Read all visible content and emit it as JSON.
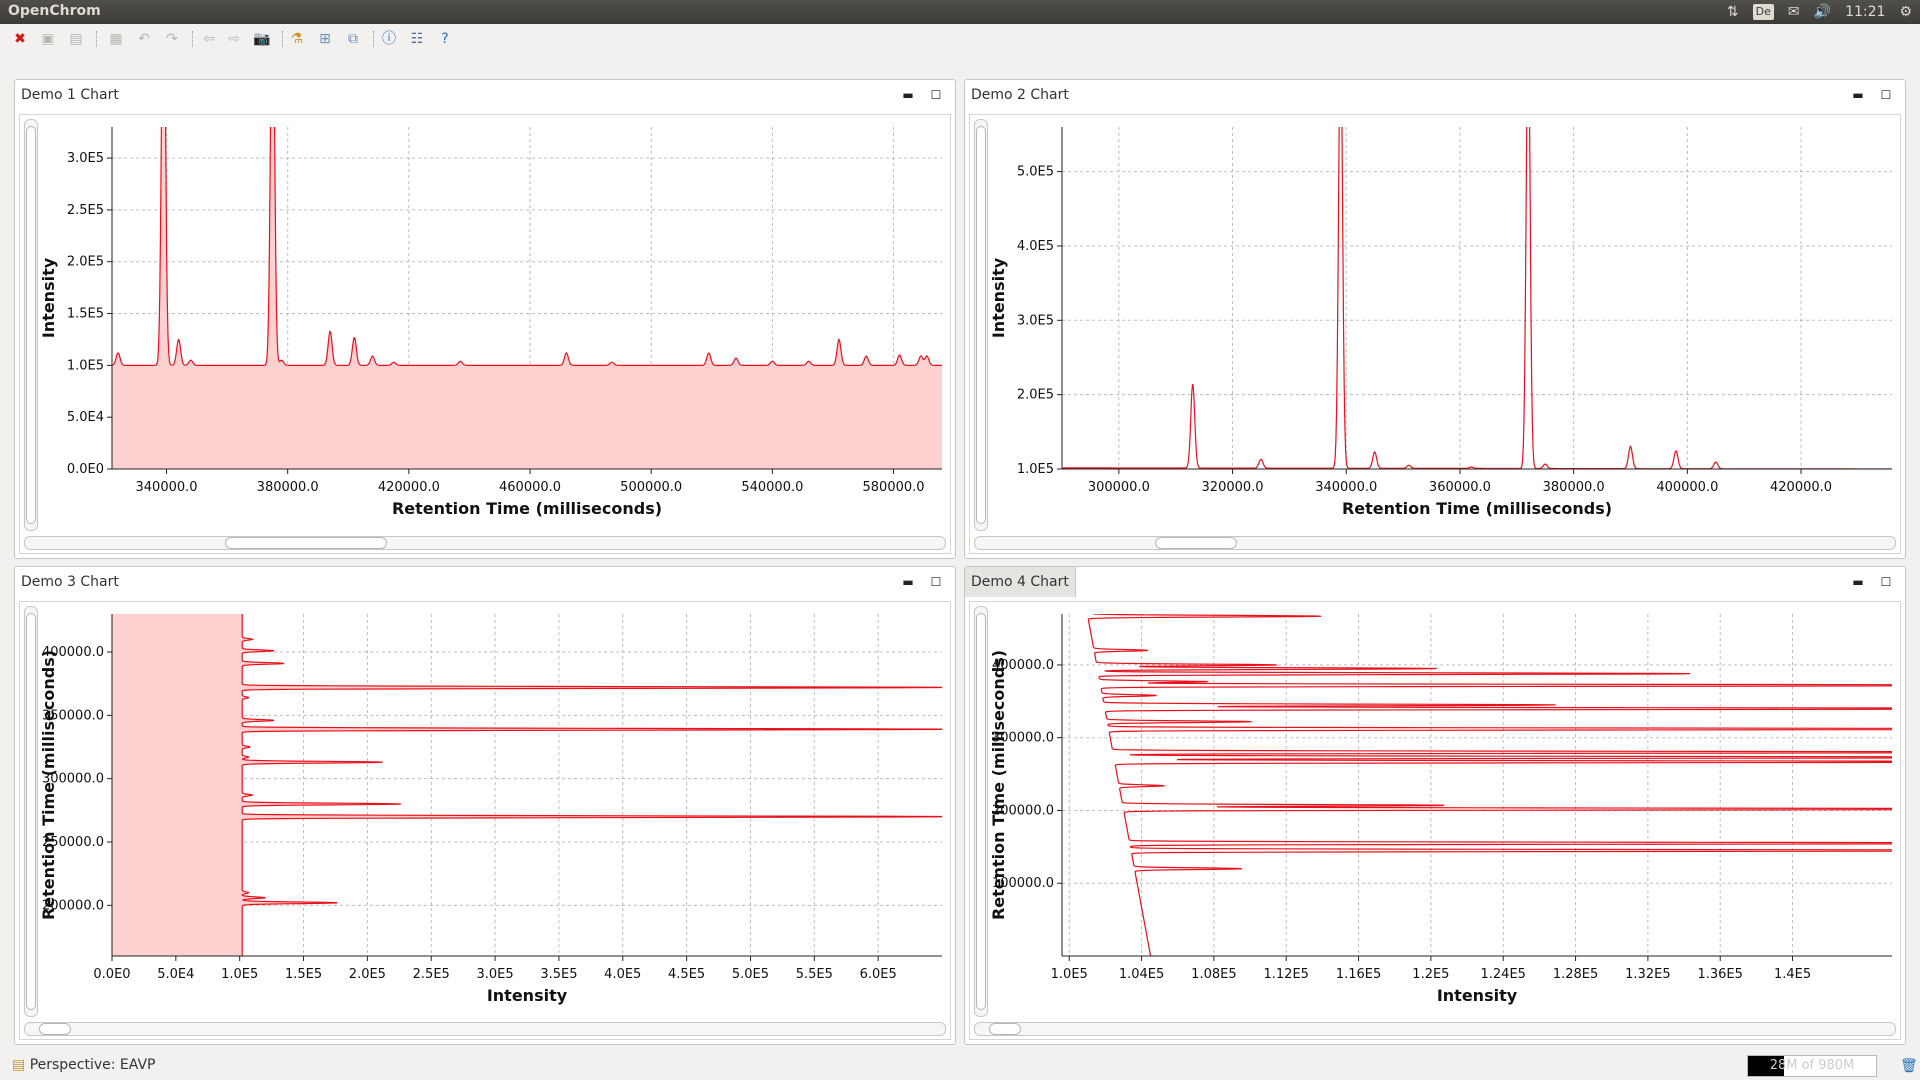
{
  "app": {
    "title": "OpenChrom"
  },
  "tray": {
    "keyboard": "De",
    "time": "11:21"
  },
  "toolbar": {
    "icons": [
      "close-icon",
      "save-icon",
      "save-all-icon",
      "save-as-icon",
      "undo-icon",
      "redo-icon",
      "back-icon",
      "forward-icon",
      "camera-icon",
      "process-icon",
      "perspective-icon",
      "window-icon",
      "info-icon",
      "preferences-icon",
      "help-icon"
    ]
  },
  "parts": [
    {
      "title": "Demo 1 Chart"
    },
    {
      "title": "Demo 2 Chart"
    },
    {
      "title": "Demo 3 Chart"
    },
    {
      "title": "Demo 4 Chart"
    }
  ],
  "status": {
    "perspective": "Perspective: EAVP",
    "heap": "28M of 980M"
  },
  "colors": {
    "trace": "#e8101a",
    "fill": "#ffd0d0",
    "grid": "#bdbdbd"
  },
  "chart_data": [
    {
      "type": "area",
      "orientation": "vertical",
      "xlabel": "Retention Time (milliseconds)",
      "ylabel": "Intensity",
      "xlim": [
        322000,
        596000
      ],
      "ylim": [
        0,
        330000
      ],
      "xticks": [
        340000,
        380000,
        420000,
        460000,
        500000,
        540000,
        580000
      ],
      "xtick_labels": [
        "340000.0",
        "380000.0",
        "420000.0",
        "460000.0",
        "500000.0",
        "540000.0",
        "580000.0"
      ],
      "yticks": [
        0,
        50000,
        100000,
        150000,
        200000,
        250000,
        300000
      ],
      "ytick_labels": [
        "0.0E0",
        "5.0E4",
        "1.0E5",
        "1.5E5",
        "2.0E5",
        "2.5E5",
        "3.0E5"
      ],
      "baseline": 100000,
      "baseline_drift": 0,
      "fill": true,
      "peaks": [
        [
          324000,
          12000
        ],
        [
          339000,
          400000
        ],
        [
          344000,
          25000
        ],
        [
          348000,
          5000
        ],
        [
          375000,
          400000
        ],
        [
          378000,
          5000
        ],
        [
          394000,
          33000
        ],
        [
          402000,
          27000
        ],
        [
          408000,
          9000
        ],
        [
          415000,
          3000
        ],
        [
          437000,
          4000
        ],
        [
          472000,
          12000
        ],
        [
          487000,
          3000
        ],
        [
          519000,
          12000
        ],
        [
          528000,
          7000
        ],
        [
          540000,
          4000
        ],
        [
          552000,
          4000
        ],
        [
          562000,
          25000
        ],
        [
          571000,
          9000
        ],
        [
          582000,
          10000
        ],
        [
          589000,
          9000
        ],
        [
          591000,
          9000
        ]
      ]
    },
    {
      "type": "line",
      "orientation": "vertical",
      "xlabel": "Retention Time (milliseconds)",
      "ylabel": "Intensity",
      "xlim": [
        290000,
        436000
      ],
      "ylim": [
        100000,
        560000
      ],
      "xticks": [
        300000,
        320000,
        340000,
        360000,
        380000,
        400000,
        420000
      ],
      "xtick_labels": [
        "300000.0",
        "320000.0",
        "340000.0",
        "360000.0",
        "380000.0",
        "400000.0",
        "420000.0"
      ],
      "yticks": [
        100000,
        200000,
        300000,
        400000,
        500000
      ],
      "ytick_labels": [
        "1.0E5",
        "2.0E5",
        "3.0E5",
        "4.0E5",
        "5.0E5"
      ],
      "baseline": 101500,
      "baseline_drift": -1500,
      "fill": false,
      "peaks": [
        [
          313000,
          113000
        ],
        [
          325000,
          12000
        ],
        [
          339000,
          600000
        ],
        [
          345000,
          22000
        ],
        [
          351000,
          4000
        ],
        [
          362000,
          2000
        ],
        [
          372000,
          600000
        ],
        [
          375000,
          6000
        ],
        [
          390000,
          30000
        ],
        [
          398000,
          24000
        ],
        [
          405000,
          9000
        ]
      ]
    },
    {
      "type": "area",
      "orientation": "horizontal",
      "xlabel": "Intensity",
      "ylabel": "Retention Time (milliseconds)",
      "xlim": [
        0,
        650000
      ],
      "ylim": [
        160000,
        430000
      ],
      "xticks": [
        0,
        50000,
        100000,
        150000,
        200000,
        250000,
        300000,
        350000,
        400000,
        450000,
        500000,
        550000,
        600000
      ],
      "xtick_labels": [
        "0.0E0",
        "5.0E4",
        "1.0E5",
        "1.5E5",
        "2.0E5",
        "2.5E5",
        "3.0E5",
        "3.5E5",
        "4.0E5",
        "4.5E5",
        "5.0E5",
        "5.5E5",
        "6.0E5"
      ],
      "yticks": [
        200000,
        250000,
        300000,
        350000,
        400000
      ],
      "ytick_labels": [
        "200000.0",
        "250000.0",
        "300000.0",
        "350000.0",
        "400000.0"
      ],
      "baseline": 102000,
      "baseline_drift": 0,
      "fill": true,
      "peaks": [
        [
          202000,
          75000
        ],
        [
          206000,
          18000
        ],
        [
          210000,
          5000
        ],
        [
          270000,
          560000
        ],
        [
          280000,
          125000
        ],
        [
          287000,
          8000
        ],
        [
          313000,
          110000
        ],
        [
          317000,
          5000
        ],
        [
          325000,
          6000
        ],
        [
          339000,
          560000
        ],
        [
          346000,
          25000
        ],
        [
          364000,
          5000
        ],
        [
          372000,
          560000
        ],
        [
          391000,
          33000
        ],
        [
          401000,
          25000
        ],
        [
          410000,
          8000
        ]
      ]
    },
    {
      "type": "line",
      "orientation": "horizontal",
      "xlabel": "Intensity",
      "ylabel": "Retention Time (milliseconds)",
      "xlim": [
        99600,
        145500
      ],
      "ylim": [
        0,
        470000
      ],
      "xticks": [
        100000,
        104000,
        108000,
        112000,
        116000,
        120000,
        124000,
        128000,
        132000,
        136000,
        140000
      ],
      "xtick_labels": [
        "1.0E5",
        "1.04E5",
        "1.08E5",
        "1.12E5",
        "1.16E5",
        "1.2E5",
        "1.24E5",
        "1.28E5",
        "1.32E5",
        "1.36E5",
        "1.4E5"
      ],
      "yticks": [
        100000,
        200000,
        300000,
        400000
      ],
      "ytick_labels": [
        "100000.0",
        "200000.0",
        "300000.0",
        "400000.0"
      ],
      "baseline": 104500,
      "baseline_drift": -3500,
      "fill": false,
      "peaks": [
        [
          120000,
          6000
        ],
        [
          145000,
          60000
        ],
        [
          155000,
          60000
        ],
        [
          202000,
          60000
        ],
        [
          207000,
          18000
        ],
        [
          234000,
          2500
        ],
        [
          267000,
          60000
        ],
        [
          273000,
          60000
        ],
        [
          280000,
          60000
        ],
        [
          312000,
          60000
        ],
        [
          322000,
          8000
        ],
        [
          340000,
          60000
        ],
        [
          345000,
          25000
        ],
        [
          358000,
          3000
        ],
        [
          372000,
          60000
        ],
        [
          377000,
          6000
        ],
        [
          388000,
          33000
        ],
        [
          395000,
          19000
        ],
        [
          400000,
          10000
        ],
        [
          420000,
          3000
        ],
        [
          467000,
          13000
        ]
      ]
    }
  ]
}
